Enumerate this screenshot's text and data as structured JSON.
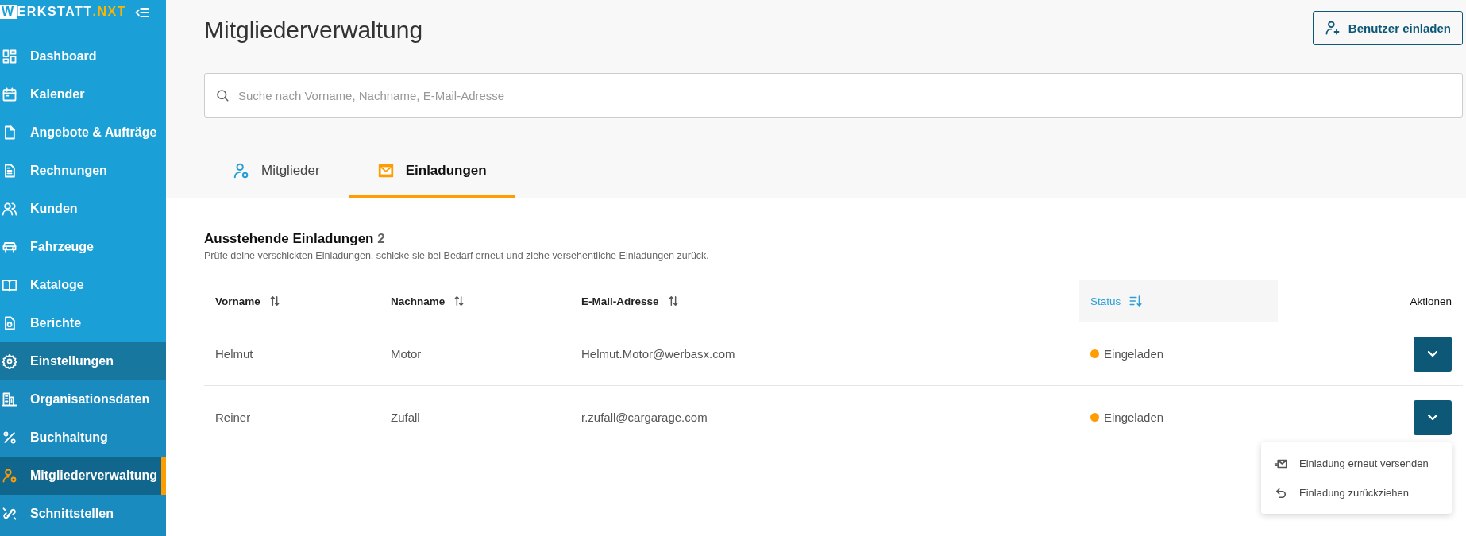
{
  "sidebar": {
    "logo": {
      "initial": "W",
      "name": "ERKSTATT",
      "suffix": ".NXT"
    },
    "items": [
      {
        "label": "Dashboard",
        "selected": false
      },
      {
        "label": "Kalender",
        "selected": false
      },
      {
        "label": "Angebote & Aufträge",
        "selected": false
      },
      {
        "label": "Rechnungen",
        "selected": false
      },
      {
        "label": "Kunden",
        "selected": false
      },
      {
        "label": "Fahrzeuge",
        "selected": false
      },
      {
        "label": "Kataloge",
        "selected": false
      },
      {
        "label": "Berichte",
        "selected": false
      },
      {
        "label": "Einstellungen",
        "selected": false,
        "children": [
          {
            "label": "Organisationsdaten",
            "selected": false
          },
          {
            "label": "Buchhaltung",
            "selected": false
          },
          {
            "label": "Mitgliederverwaltung",
            "selected": true
          },
          {
            "label": "Schnittstellen",
            "selected": false
          }
        ]
      }
    ]
  },
  "page": {
    "title": "Mitgliederverwaltung",
    "invite_button": "Benutzer einladen",
    "search": {
      "placeholder": "Suche nach Vorname, Nachname, E-Mail-Adresse"
    }
  },
  "tabs": [
    {
      "label": "Mitglieder",
      "selected": false
    },
    {
      "label": "Einladungen",
      "selected": true
    }
  ],
  "section": {
    "title": "Ausstehende Einladungen",
    "count": "2",
    "description": "Prüfe deine verschickten Einladungen, schicke sie bei Bedarf erneut und ziehe versehentliche Einladungen zurück."
  },
  "table": {
    "columns": [
      {
        "label": "Vorname",
        "sortable": true,
        "sorted": false
      },
      {
        "label": "Nachname",
        "sortable": true,
        "sorted": false
      },
      {
        "label": "E-Mail-Adresse",
        "sortable": true,
        "sorted": false
      },
      {
        "label": "Status",
        "sortable": true,
        "sorted": true
      },
      {
        "label": "Aktionen",
        "sortable": false,
        "sorted": false
      }
    ],
    "rows": [
      {
        "first_name": "Helmut",
        "last_name": "Motor",
        "email": "Helmut.Motor@werbasx.com",
        "status": "Eingeladen",
        "color": "#ff9c00"
      },
      {
        "first_name": "Reiner",
        "last_name": "Zufall",
        "email": "r.zufall@cargarage.com",
        "status": "Eingeladen",
        "color": "#ff9c00",
        "menu": {
          "items": [
            {
              "label": "Einladung erneut versenden"
            },
            {
              "label": "Einladung zurückziehen"
            }
          ]
        }
      }
    ]
  }
}
